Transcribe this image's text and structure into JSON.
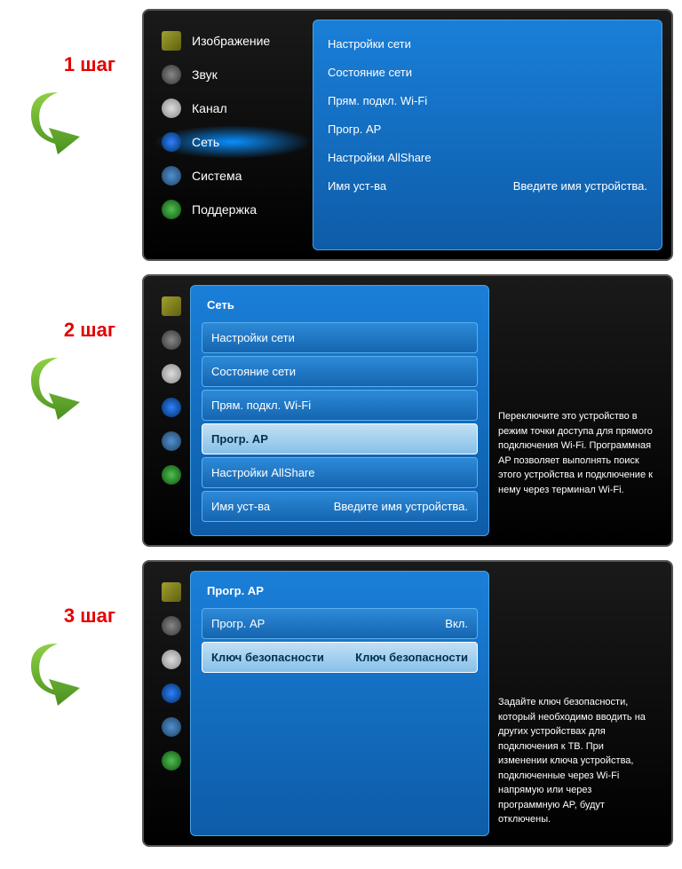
{
  "steps": {
    "s1": "1 шаг",
    "s2": "2 шаг",
    "s3": "3 шаг"
  },
  "menu": {
    "image": "Изображение",
    "sound": "Звук",
    "channel": "Канал",
    "network": "Сеть",
    "system": "Система",
    "support": "Поддержка"
  },
  "net": {
    "title": "Сеть",
    "settings": "Настройки сети",
    "status": "Состояние сети",
    "wifi": "Прям. подкл. Wi-Fi",
    "softap": "Прогр. AP",
    "allshare": "Настройки AllShare",
    "devname": "Имя уст-ва",
    "devname_val": "Введите имя устройства."
  },
  "ap": {
    "title": "Прогр. AP",
    "row1": "Прогр. AP",
    "row1v": "Вкл.",
    "row2": "Ключ безопасности",
    "row2v": "Ключ безопасности"
  },
  "info2": "Переключите это устройство в режим точки доступа для прямого подключения Wi-Fi. Программная AP позволяет выполнять поиск этого устройства и подключение к нему через терминал Wi-Fi.",
  "info3": "Задайте ключ безопасности, который необходимо вводить на других устройствах для подключения к ТВ. При изменении ключа устройства, подключенные через Wi-Fi напрямую или через программную AP, будут отключены."
}
